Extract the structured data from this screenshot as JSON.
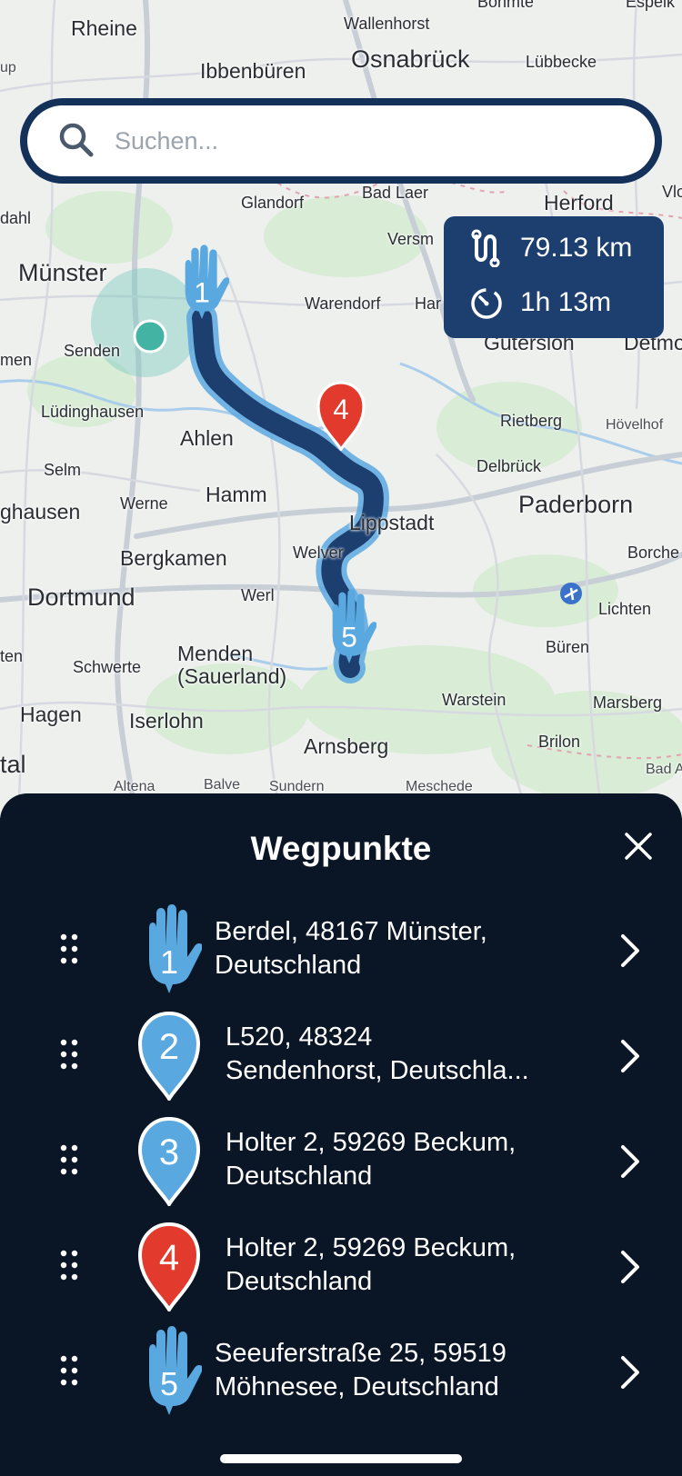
{
  "map": {
    "labels": [
      {
        "text": "Rheine",
        "cls": "ml-mid"
      },
      {
        "text": "Wallenhorst",
        "cls": "ml-sm"
      },
      {
        "text": "Bohmte",
        "cls": "ml-sm"
      },
      {
        "text": "Espelk",
        "cls": "ml-sm"
      },
      {
        "text": "Ibbenbüren",
        "cls": "ml-mid"
      },
      {
        "text": "Osnabrück",
        "cls": "ml-big"
      },
      {
        "text": "Lübbecke",
        "cls": "ml-sm"
      },
      {
        "text": "Glandorf",
        "cls": "ml-sm"
      },
      {
        "text": "Bad Laer",
        "cls": "ml-sm"
      },
      {
        "text": "Herford",
        "cls": "ml-mid"
      },
      {
        "text": "Versm",
        "cls": "ml-sm"
      },
      {
        "text": "Münster",
        "cls": "ml-big"
      },
      {
        "text": "Warendorf",
        "cls": "ml-sm"
      },
      {
        "text": "Har",
        "cls": "ml-sm"
      },
      {
        "text": "Senden",
        "cls": "ml-sm"
      },
      {
        "text": "Gütersloh",
        "cls": "ml-mid"
      },
      {
        "text": "Detmo",
        "cls": "ml-mid"
      },
      {
        "text": "Lüdinghausen",
        "cls": "ml-sm"
      },
      {
        "text": "Ahlen",
        "cls": "ml-mid"
      },
      {
        "text": "Rietberg",
        "cls": "ml-sm"
      },
      {
        "text": "Hövelhof",
        "cls": "ml-xs"
      },
      {
        "text": "Selm",
        "cls": "ml-sm"
      },
      {
        "text": "Delbrück",
        "cls": "ml-sm"
      },
      {
        "text": "Hamm",
        "cls": "ml-mid"
      },
      {
        "text": "Werne",
        "cls": "ml-sm"
      },
      {
        "text": "ghausen",
        "cls": "ml-mid"
      },
      {
        "text": "Paderborn",
        "cls": "ml-big"
      },
      {
        "text": "Lippstadt",
        "cls": "ml-mid"
      },
      {
        "text": "Welver",
        "cls": "ml-sm"
      },
      {
        "text": "Bergkamen",
        "cls": "ml-mid"
      },
      {
        "text": "Borche",
        "cls": "ml-sm"
      },
      {
        "text": "Dortmund",
        "cls": "ml-big"
      },
      {
        "text": "Werl",
        "cls": "ml-sm"
      },
      {
        "text": "Lichten",
        "cls": "ml-sm"
      },
      {
        "text": "Menden",
        "cls": "ml-mid"
      },
      {
        "text": "(Sauerland)",
        "cls": "ml-mid"
      },
      {
        "text": "Schwerte",
        "cls": "ml-sm"
      },
      {
        "text": "Büren",
        "cls": "ml-sm"
      },
      {
        "text": "Hagen",
        "cls": "ml-mid"
      },
      {
        "text": "Iserlohn",
        "cls": "ml-mid"
      },
      {
        "text": "Warstein",
        "cls": "ml-sm"
      },
      {
        "text": "Marsberg",
        "cls": "ml-sm"
      },
      {
        "text": "Arnsberg",
        "cls": "ml-mid"
      },
      {
        "text": "Brilon",
        "cls": "ml-sm"
      },
      {
        "text": "Altena",
        "cls": "ml-xs"
      },
      {
        "text": "Balve",
        "cls": "ml-xs"
      },
      {
        "text": "Sundern",
        "cls": "ml-xs"
      },
      {
        "text": "Meschede",
        "cls": "ml-xs"
      },
      {
        "text": "Bad A",
        "cls": "ml-xs"
      },
      {
        "text": "dahl",
        "cls": "ml-sm"
      },
      {
        "text": "men",
        "cls": "ml-sm"
      },
      {
        "text": "ten",
        "cls": "ml-sm"
      },
      {
        "text": "tal",
        "cls": "ml-big"
      },
      {
        "text": "Vlo",
        "cls": "ml-sm"
      },
      {
        "text": "up",
        "cls": "ml-xs"
      }
    ],
    "markers": {
      "m1": "1",
      "m4": "4",
      "m5": "5"
    }
  },
  "search": {
    "placeholder": "Suchen..."
  },
  "stats": {
    "distance": "79.13 km",
    "duration": "1h 13m"
  },
  "sheet": {
    "title": "Wegpunkte",
    "waypoints": [
      {
        "num": "1",
        "line1": "Berdel, 48167 Münster,",
        "line2": "Deutschland",
        "icon": "hand-icon",
        "color": "#5aa8e0"
      },
      {
        "num": "2",
        "line1": "L520, 48324",
        "line2": "Sendenhorst, Deutschla...",
        "icon": "pin-icon",
        "color": "#5aa8e0"
      },
      {
        "num": "3",
        "line1": "Holter 2, 59269 Beckum,",
        "line2": "Deutschland",
        "icon": "pin-icon",
        "color": "#5aa8e0"
      },
      {
        "num": "4",
        "line1": "Holter 2, 59269 Beckum,",
        "line2": "Deutschland",
        "icon": "pin-icon",
        "color": "#e23b2e"
      },
      {
        "num": "5",
        "line1": "Seeuferstraße 25, 59519",
        "line2": "Möhnesee, Deutschland",
        "icon": "hand-icon",
        "color": "#5aa8e0"
      }
    ]
  },
  "colors": {
    "route": "#1c3f70",
    "route_glow": "#5aa8e0",
    "sheet_bg": "#0a1626",
    "pin_blue": "#5aa8e0",
    "pin_red": "#e23b2e"
  }
}
